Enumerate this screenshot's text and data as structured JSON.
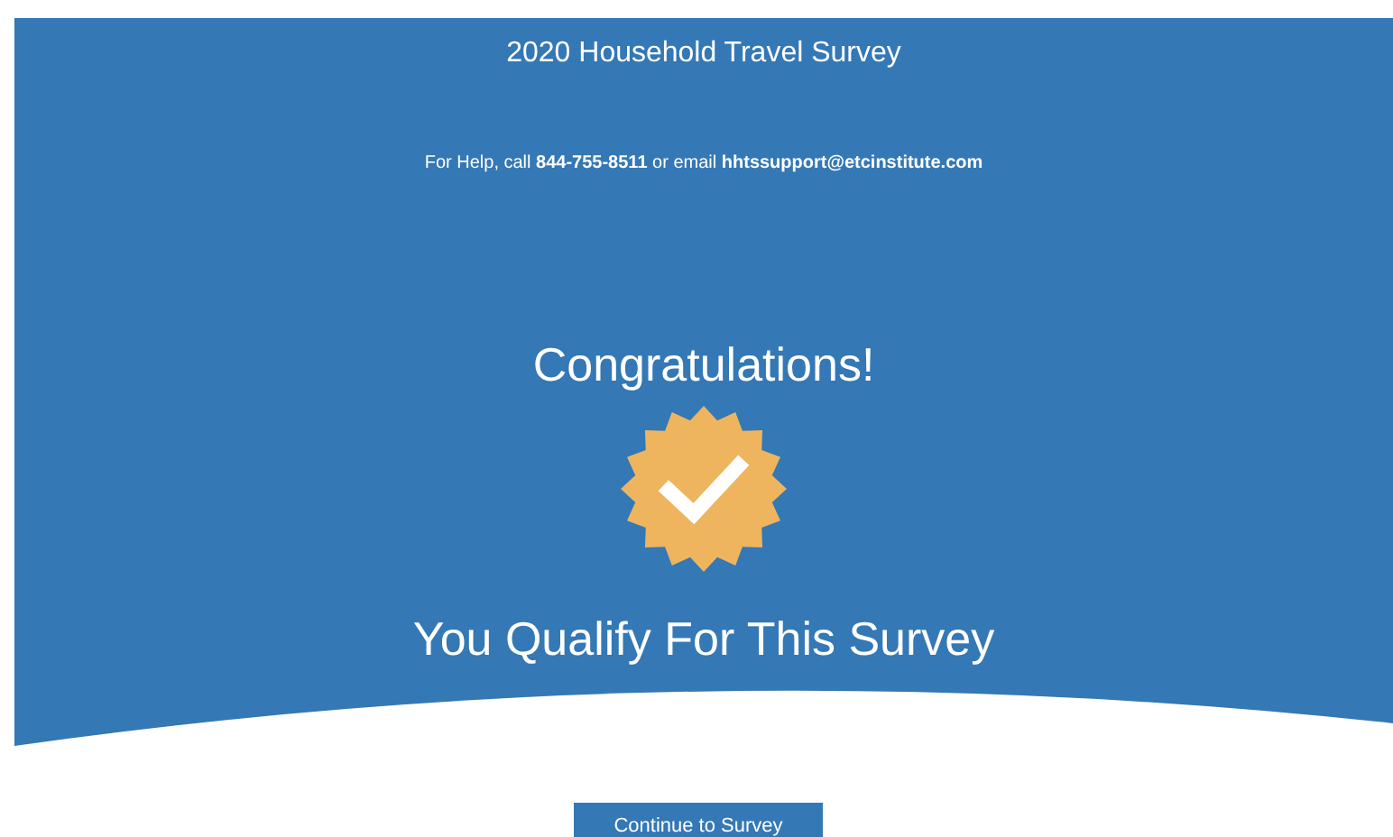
{
  "header": {
    "title": "2020 Household Travel Survey",
    "help": "For Help, call **844-755-8511** or email **hhtssupport@etcinstitute.com**"
  },
  "result": {
    "heading": "Congratulations!",
    "message": "You Qualify For This Survey"
  },
  "buttons": [
    {
      "label": "Continue to Survey"
    }
  ]
}
